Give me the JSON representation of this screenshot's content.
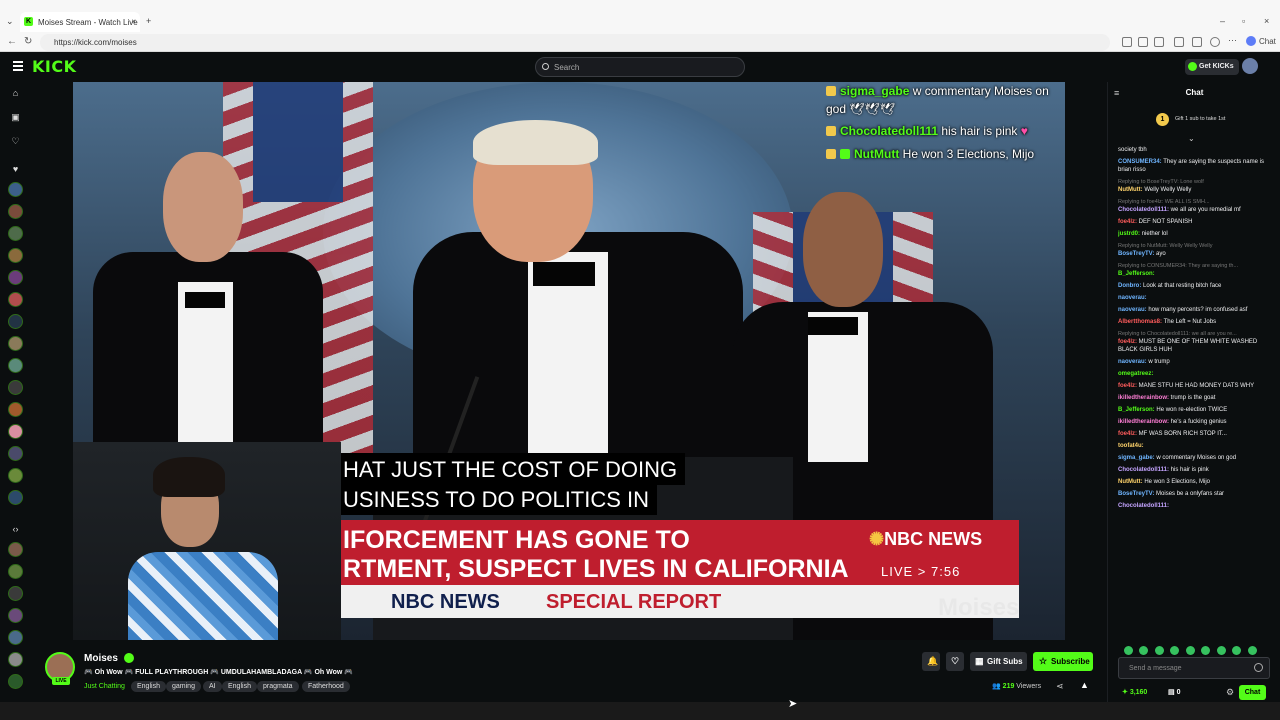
{
  "browser": {
    "tab_title": "Moises Stream - Watch Live o...",
    "url": "https://kick.com/moises",
    "chat_label": "Chat"
  },
  "header": {
    "logo": "KICK",
    "search_placeholder": "Search",
    "get_kicks": "Get KICKs"
  },
  "video": {
    "overlay_chat": [
      {
        "user": "sigma_gabe",
        "text": " w commentary Moises on"
      },
      {
        "user": "",
        "text": "god"
      },
      {
        "user": "Chocolatedoll111",
        "text": " his hair is pink"
      },
      {
        "user": "NutMutt",
        "text": " He won 3 Elections, Mijo"
      }
    ],
    "caption_line1": "HAT JUST THE COST OF DOING",
    "caption_line2": "USINESS TO DO POLITICS IN",
    "lower_third_line1": "IFORCEMENT HAS GONE TO",
    "lower_third_line2": "RTMENT, SUSPECT LIVES IN CALIFORNIA",
    "network": "NBC NEWS",
    "live_time": "LIVE  >  7:56",
    "network2": "NBC NEWS",
    "special_report": "SPECIAL REPORT",
    "watermark": "Moises"
  },
  "stream": {
    "streamer": "Moises",
    "live_badge": "LIVE",
    "title": "🎮 Oh Wow 🎮 FULL PLAYTHROUGH 🎮 UMDULAHAMBLADAGA 🎮 Oh Wow 🎮",
    "category": "Just Chatting",
    "tags": [
      "English",
      "gaming",
      "AI",
      "English",
      "pragmata",
      "Fatherhood"
    ],
    "gift_subs": "Gift Subs",
    "subscribe": "Subscribe",
    "viewers_count": "219",
    "viewers_label": " Viewers"
  },
  "chat": {
    "title": "Chat",
    "gift_banner_number": "1",
    "gift_banner_text": "Gift 1 sub to take 1st",
    "messages": [
      {
        "reply": "",
        "user": "",
        "text": "society tbh",
        "color": "c1"
      },
      {
        "reply": "",
        "user": "CONSUMER34:",
        "text": " They are saying the suspects name is brian risso",
        "color": "c1"
      },
      {
        "reply": "Replying to BoseTreyTV: Lone wolf",
        "user": "NutMutt:",
        "text": " Welly Welly Welly",
        "color": "c5"
      },
      {
        "reply": "Replying to foe4lz: WE ALL IS SMH...",
        "user": "Chocolatedoll111:",
        "text": " we all are you remedial mf",
        "color": "c4"
      },
      {
        "reply": "",
        "user": "foe4lz:",
        "text": " DEF NOT SPANISH",
        "color": "c3"
      },
      {
        "reply": "",
        "user": "justrd0:",
        "text": " niether lol",
        "color": "c2"
      },
      {
        "reply": "Replying to NutMutt: Welly Welly Welly",
        "user": "BoseTreyTV:",
        "text": " ayo",
        "color": "c1"
      },
      {
        "reply": "Replying to CONSUMER34: They are saying th...",
        "user": "B_Jefferson:",
        "text": "",
        "color": "c2"
      },
      {
        "reply": "",
        "user": "Donbro:",
        "text": " Look at that resting bitch face",
        "color": "c1"
      },
      {
        "reply": "",
        "user": "naoverau:",
        "text": "",
        "color": "c1"
      },
      {
        "reply": "",
        "user": "naoverau:",
        "text": " how many percents? im confused asf",
        "color": "c1"
      },
      {
        "reply": "",
        "user": "Albertthomas8:",
        "text": " The Left = Nut Jobs",
        "color": "c3"
      },
      {
        "reply": "Replying to Chocolatedoll111: we all are you re...",
        "user": "foe4lz:",
        "text": " MUST BE ONE OF THEM WHITE WASHED BLACK GIRLS HUH",
        "color": "c3"
      },
      {
        "reply": "",
        "user": "naoverau:",
        "text": " w trump",
        "color": "c1"
      },
      {
        "reply": "",
        "user": "omegatreez:",
        "text": "",
        "color": "c2"
      },
      {
        "reply": "",
        "user": "foe4lz:",
        "text": " MANE STFU HE HAD MONEY DATS WHY",
        "color": "c3"
      },
      {
        "reply": "",
        "user": "ikilledtherainbow:",
        "text": " trump is the goat",
        "color": "c6"
      },
      {
        "reply": "",
        "user": "B_Jefferson:",
        "text": " He won re-election TWICE",
        "color": "c2"
      },
      {
        "reply": "",
        "user": "ikilledtherainbow:",
        "text": " he's a fucking genius",
        "color": "c6"
      },
      {
        "reply": "",
        "user": "foe4lz:",
        "text": " MF WAS BORN RICH STOP IT...",
        "color": "c3"
      },
      {
        "reply": "",
        "user": "toofat4u:",
        "text": "",
        "color": "c5"
      },
      {
        "reply": "",
        "user": "sigma_gabe:",
        "text": " w commentary Moises on god",
        "color": "c1"
      },
      {
        "reply": "",
        "user": "Chocolatedoll111:",
        "text": " his hair is pink",
        "color": "c4"
      },
      {
        "reply": "",
        "user": "NutMutt:",
        "text": " He won 3 Elections, Mijo",
        "color": "c5"
      },
      {
        "reply": "",
        "user": "BoseTreyTV:",
        "text": " Moises be a onlyfans star",
        "color": "c1"
      },
      {
        "reply": "",
        "user": "Chocolatedoll111:",
        "text": "",
        "color": "c4"
      }
    ],
    "input_placeholder": "Send a message",
    "points": "3,160",
    "bits": "0",
    "send_label": "Chat"
  }
}
